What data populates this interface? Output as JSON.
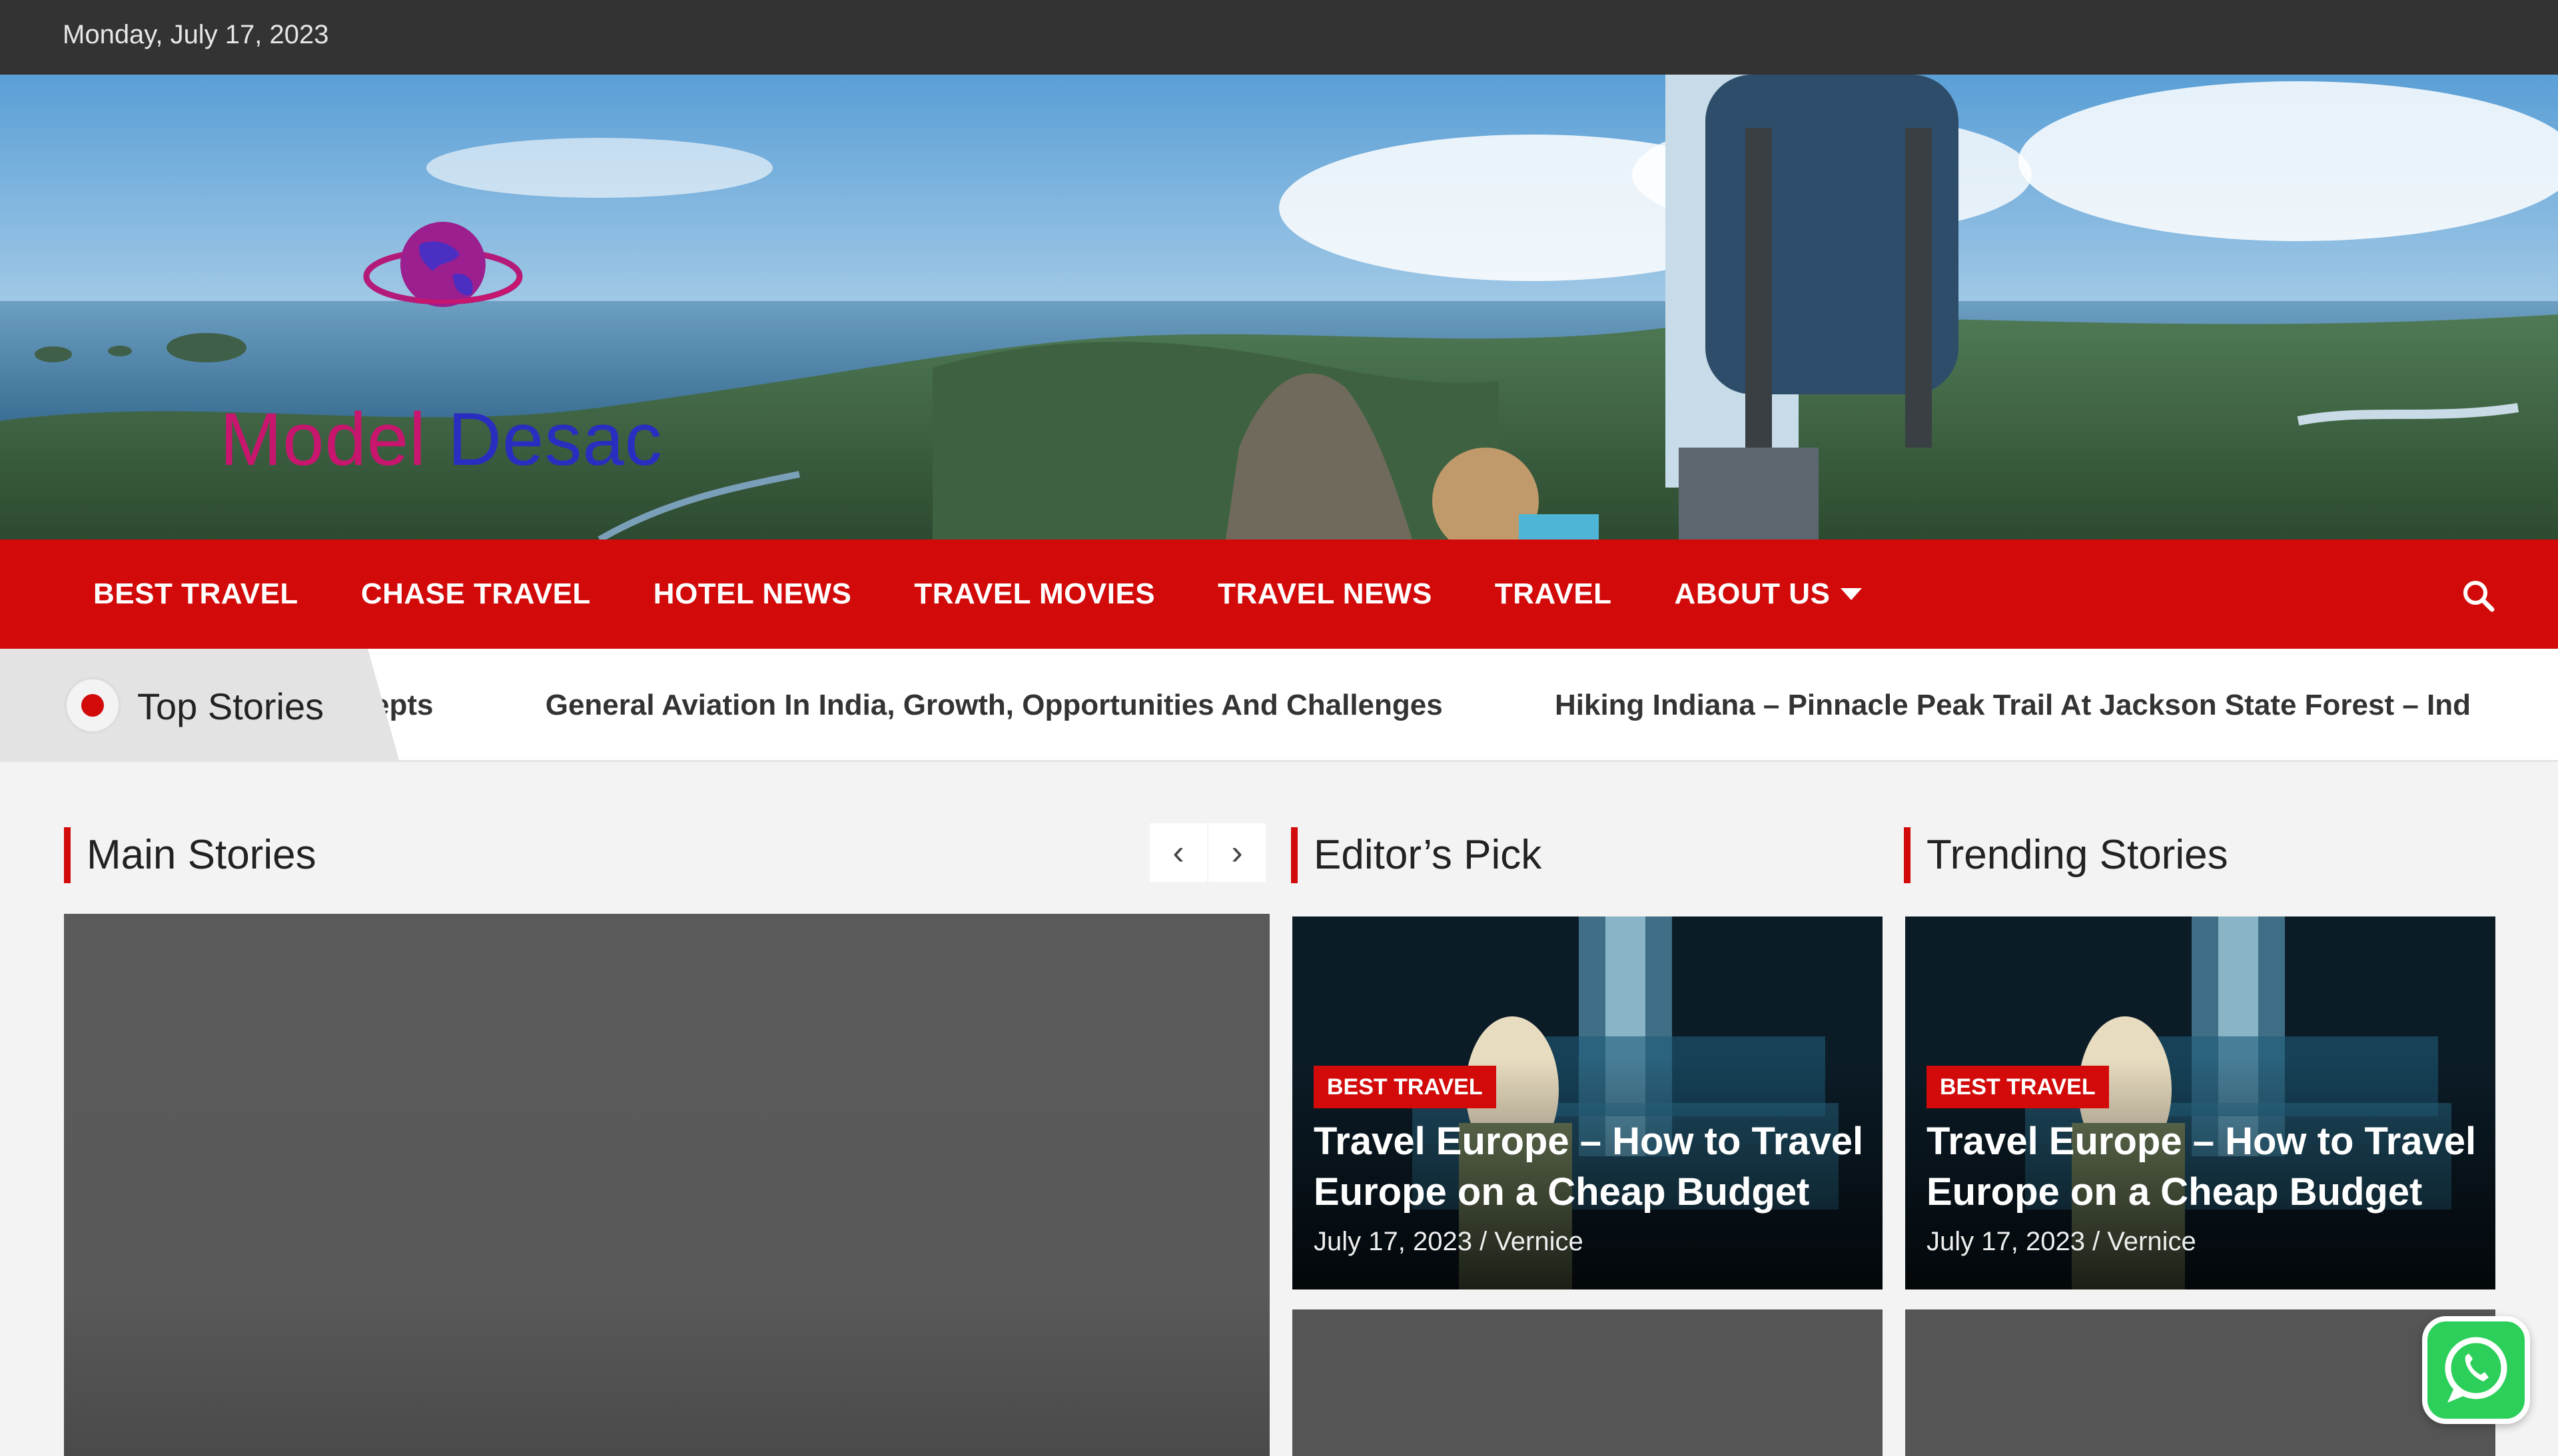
{
  "topbar": {
    "date": "Monday, July 17, 2023"
  },
  "brand": {
    "word1": "Model",
    "word2": "Desac"
  },
  "nav": {
    "items": [
      "BEST TRAVEL",
      "CHASE TRAVEL",
      "HOTEL NEWS",
      "TRAVEL MOVIES",
      "TRAVEL NEWS",
      "TRAVEL",
      "ABOUT US"
    ],
    "search_icon": "search-icon"
  },
  "ticker": {
    "label": "Top Stories",
    "items": [
      "epts",
      "General Aviation In India, Growth, Opportunities And Challenges",
      "Hiking Indiana – Pinnacle Peak Trail At Jackson State Forest – Ind"
    ]
  },
  "sections": {
    "main": {
      "title": "Main Stories",
      "prev": "‹",
      "next": "›"
    },
    "editor": {
      "title": "Editor’s Pick",
      "card": {
        "category": "BEST TRAVEL",
        "headline": "Travel Europe – How to Travel Europe on a Cheap Budget",
        "meta": "July 17, 2023 / Vernice"
      }
    },
    "trending": {
      "title": "Trending Stories",
      "card": {
        "category": "BEST TRAVEL",
        "headline": "Travel Europe – How to Travel Europe on a Cheap Budget",
        "meta": "July 17, 2023 / Vernice"
      }
    }
  },
  "colors": {
    "accent": "#d20a0a",
    "topbar": "#333333",
    "whatsapp": "#2ccf5a"
  }
}
